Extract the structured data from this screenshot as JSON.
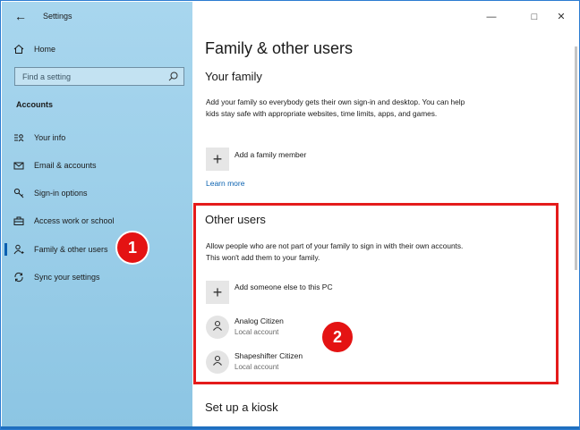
{
  "window": {
    "title": "Settings",
    "minimize_icon": "minimize-icon",
    "maximize_icon": "maximize-icon",
    "close_icon": "close-icon"
  },
  "sidebar": {
    "home_label": "Home",
    "search_placeholder": "Find a setting",
    "section_label": "Accounts",
    "items": [
      {
        "label": "Your info",
        "icon": "contact-card-icon"
      },
      {
        "label": "Email & accounts",
        "icon": "mail-icon"
      },
      {
        "label": "Sign-in options",
        "icon": "key-icon"
      },
      {
        "label": "Access work or school",
        "icon": "briefcase-icon"
      },
      {
        "label": "Family & other users",
        "icon": "person-add-icon",
        "selected": true
      },
      {
        "label": "Sync your settings",
        "icon": "sync-icon"
      }
    ]
  },
  "main": {
    "page_title": "Family & other users",
    "your_family": {
      "heading": "Your family",
      "description": "Add your family so everybody gets their own sign-in and desktop. You can help kids stay safe with appropriate websites, time limits, apps, and games.",
      "add_label": "Add a family member",
      "learn_more": "Learn more"
    },
    "other_users": {
      "heading": "Other users",
      "description": "Allow people who are not part of your family to sign in with their own accounts. This won't add them to your family.",
      "add_label": "Add someone else to this PC",
      "users": [
        {
          "name": "Analog Citizen",
          "type": "Local account"
        },
        {
          "name": "Shapeshifter Citizen",
          "type": "Local account"
        }
      ]
    },
    "kiosk": {
      "heading": "Set up a kiosk"
    }
  },
  "annotations": {
    "badge_1": "1",
    "badge_2": "2",
    "badge_color": "#e41313",
    "highlight_color": "#e41b1b"
  },
  "colors": {
    "accent": "#0b62b0",
    "sidebar_bg": "#a8d6ee"
  }
}
